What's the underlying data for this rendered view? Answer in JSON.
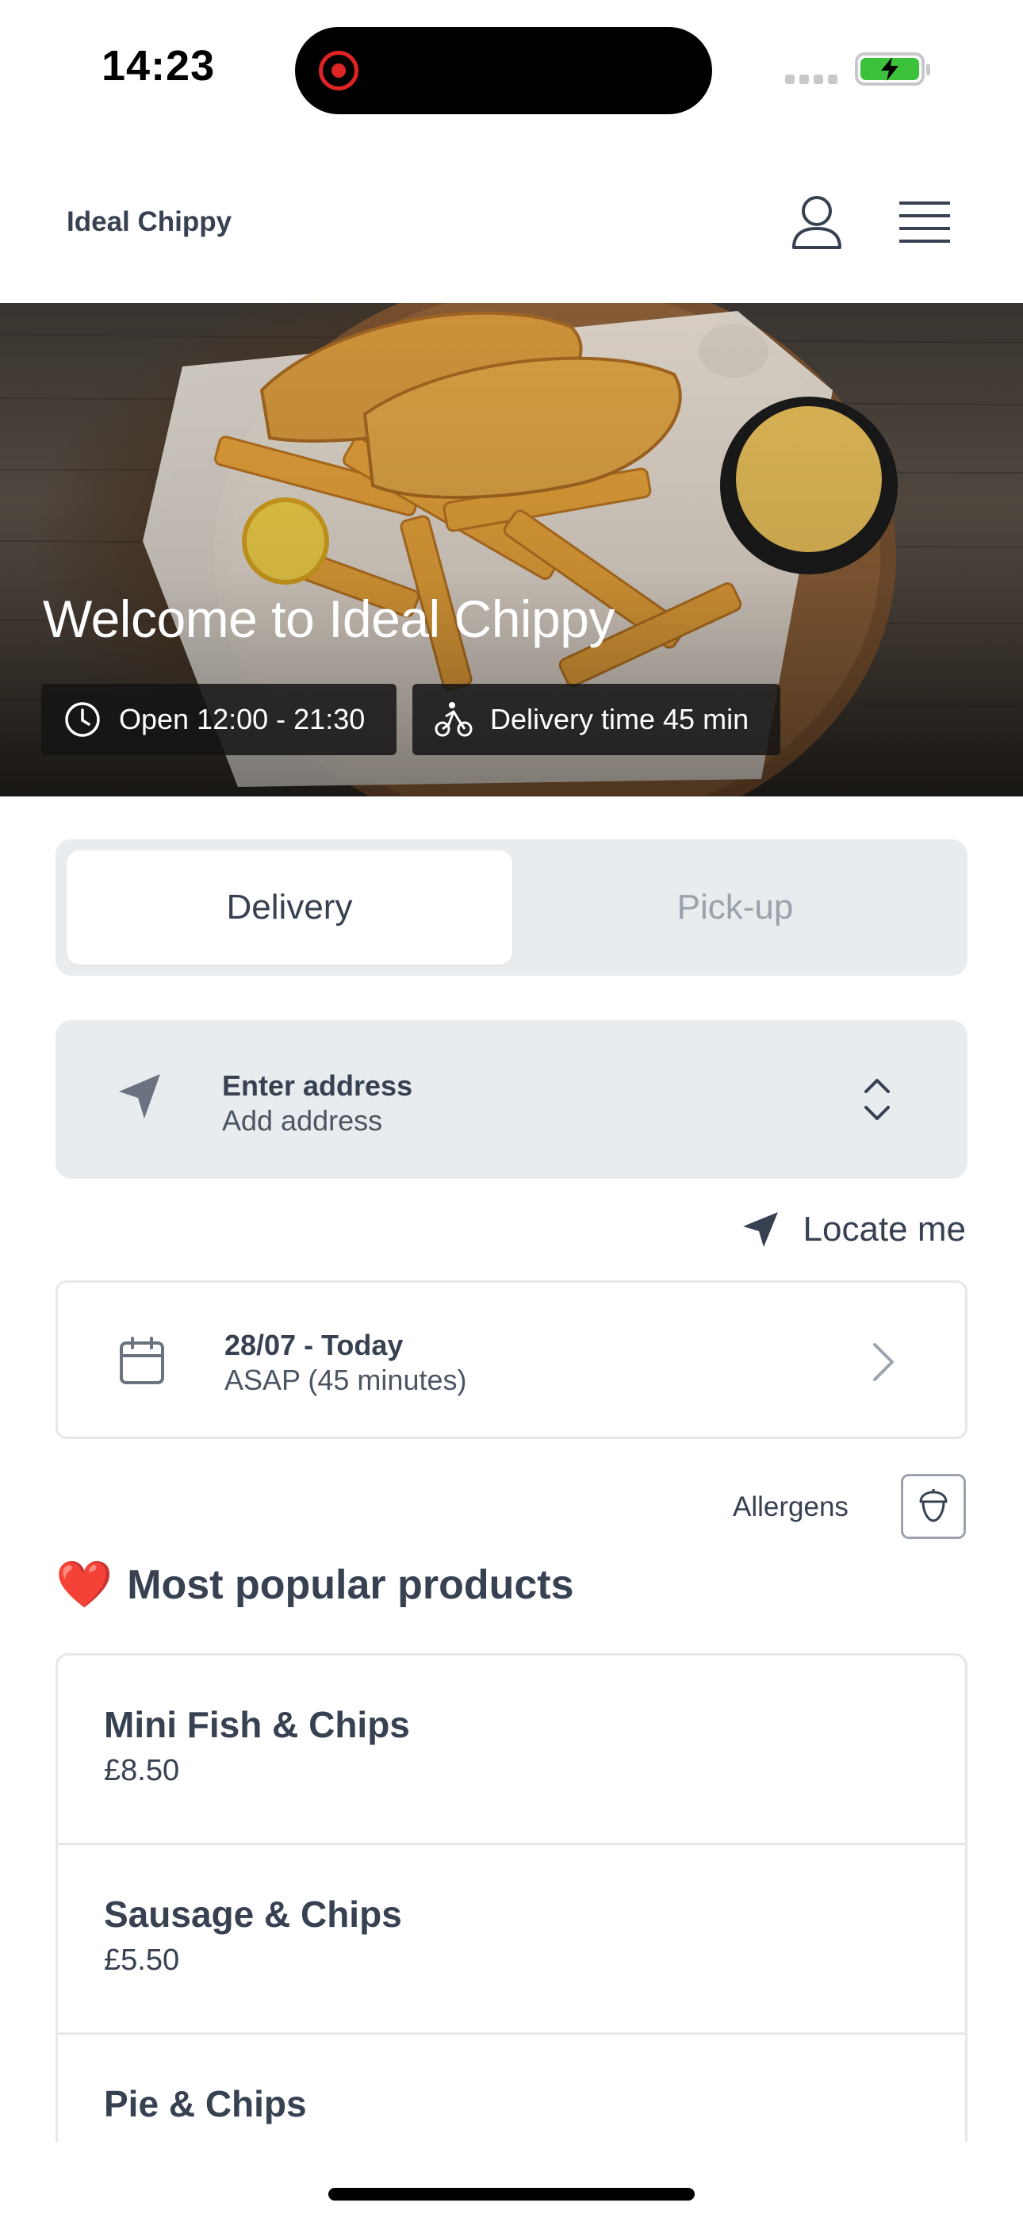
{
  "status_bar": {
    "time": "14:23"
  },
  "header": {
    "brand": "Ideal Chippy"
  },
  "hero": {
    "title": "Welcome to Ideal Chippy",
    "opening_hours": "Open 12:00 - 21:30",
    "delivery_time": "Delivery time 45 min"
  },
  "tabs": {
    "delivery": "Delivery",
    "pickup": "Pick-up",
    "active": "Delivery"
  },
  "address": {
    "title": "Enter address",
    "subtitle": "Add address"
  },
  "locate": {
    "label": "Locate me"
  },
  "date": {
    "title": "28/07 - Today",
    "subtitle": "ASAP (45 minutes)"
  },
  "allergens": {
    "label": "Allergens"
  },
  "popular": {
    "emoji": "❤️",
    "title": "Most popular products",
    "products": [
      {
        "name": "Mini Fish & Chips",
        "price": "£8.50"
      },
      {
        "name": "Sausage & Chips",
        "price": "£5.50"
      },
      {
        "name": "Pie & Chips",
        "price": ""
      }
    ]
  },
  "colors": {
    "text": "#374151",
    "panel": "#e9ecee",
    "muted": "#9aa2ab",
    "battery": "#3cc13b"
  }
}
